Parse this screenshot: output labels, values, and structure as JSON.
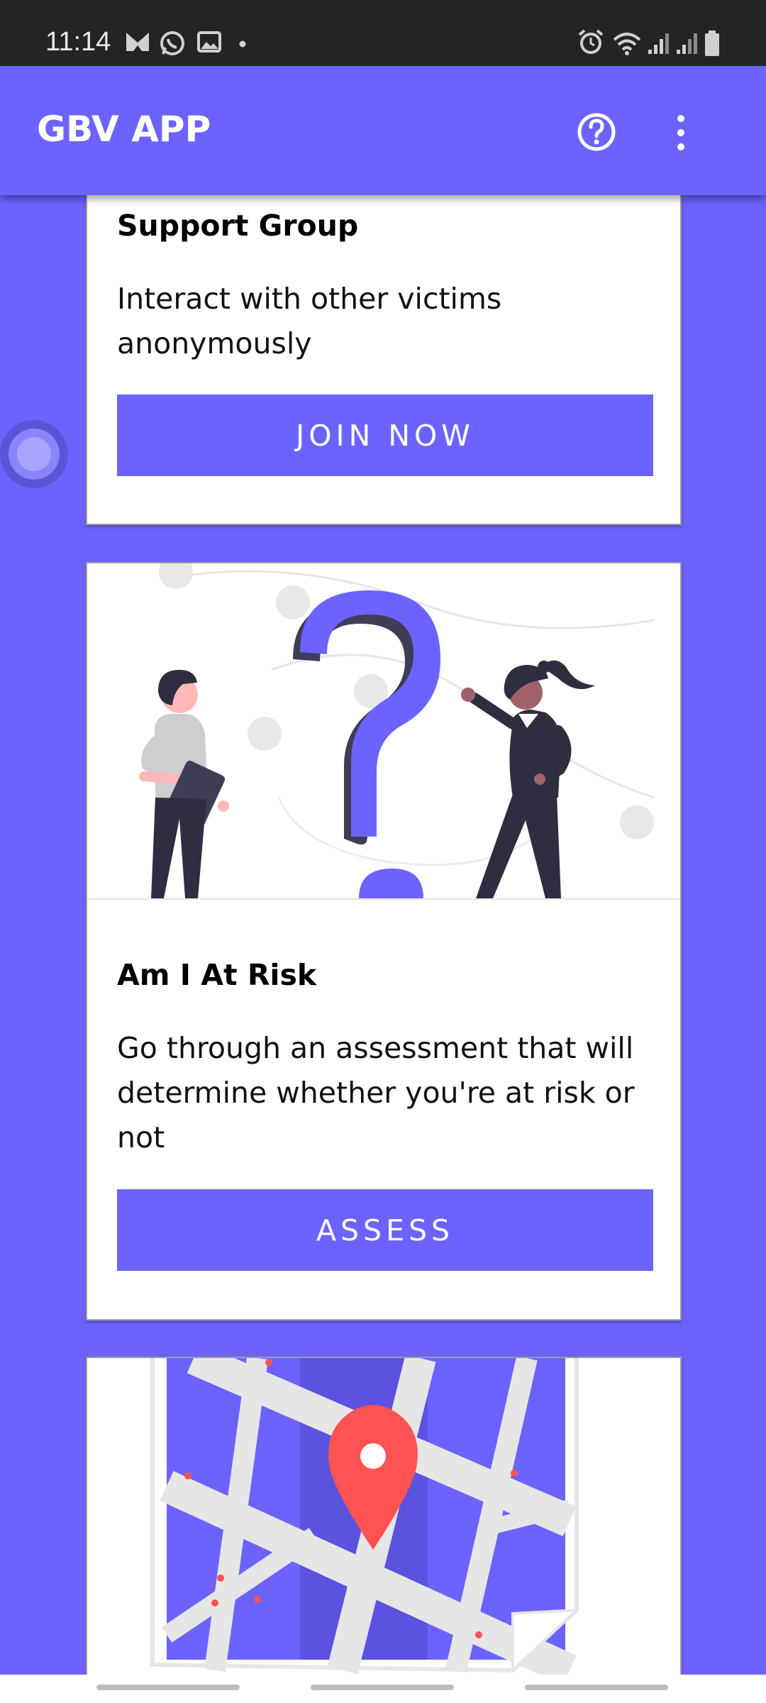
{
  "status_bar": {
    "time": "11:14",
    "left_icons": [
      "mail-icon",
      "whatsapp-icon",
      "gallery-icon",
      "dot-icon"
    ],
    "right_icons": [
      "alarm-icon",
      "wifi-icon",
      "signal-icon",
      "signal-icon",
      "battery-icon"
    ]
  },
  "app_bar": {
    "title": "GBV APP",
    "actions": [
      "help-icon",
      "more-vert-icon"
    ]
  },
  "cards": [
    {
      "title": "Support Group",
      "description": "Interact with other victims anonymously",
      "button": "JOIN NOW"
    },
    {
      "title": "Am I At Risk",
      "description": "Go through an assessment that will determine whether you're at risk or not",
      "button": "ASSESS",
      "illustration": "question-mark-illustration"
    },
    {
      "illustration": "map-pin-illustration"
    }
  ],
  "colors": {
    "primary": "#6c63ff",
    "status_bar": "#242424",
    "pin": "#ff5252",
    "figure_dark": "#2f2e41"
  }
}
